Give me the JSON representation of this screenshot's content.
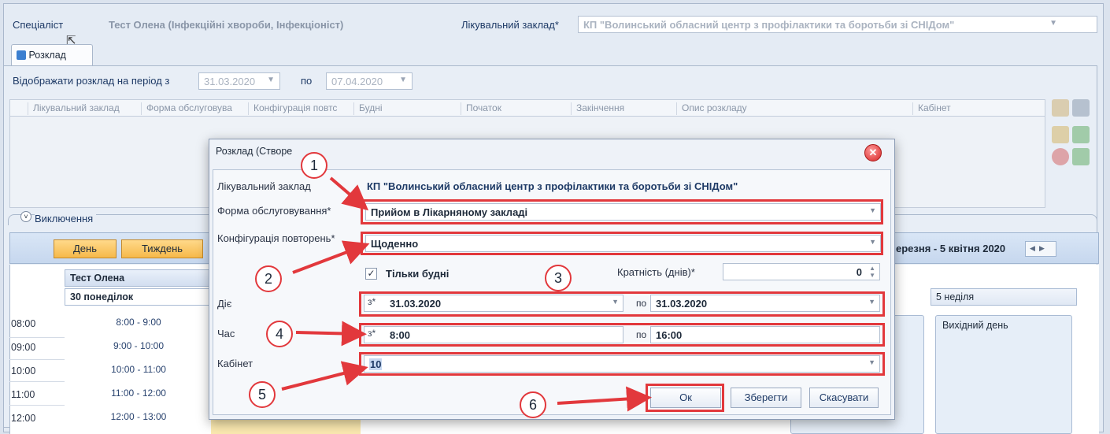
{
  "header": {
    "specialist_label": "Спеціаліст",
    "specialist_value": "Тест Олена (Інфекційні хвороби, Інфекціоніст)",
    "facility_label": "Лікувальний заклад*",
    "facility_value": "КП \"Волинський обласний центр з профілактики та боротьби зі СНІДом\""
  },
  "tab": {
    "label": "Розклад"
  },
  "period": {
    "label": "Відображати розклад на період з",
    "from": "31.03.2020",
    "to_label": "по",
    "to": "07.04.2020"
  },
  "grid": {
    "columns": [
      "Лікувальний заклад",
      "Форма обслуговува",
      "Конфігурація повтс",
      "Будні",
      "Початок",
      "Закінчення",
      "Опис розкладу",
      "Кабінет"
    ]
  },
  "exclusions": {
    "label": "Виключення"
  },
  "schedule": {
    "day_button": "День",
    "week_button": "Тиждень",
    "range_label": "ерезня - 5 квітня 2020",
    "person": "Тест Олена",
    "first_day": "30 понеділок",
    "last_day": "5 неділя",
    "day_off": "Вихідний день",
    "times": [
      "08:00",
      "09:00",
      "10:00",
      "11:00",
      "12:00"
    ],
    "slots": [
      "8:00 - 9:00",
      "9:00 - 10:00",
      "10:00 - 11:00",
      "11:00 - 12:00",
      "12:00 - 13:00"
    ]
  },
  "dialog": {
    "title": "Розклад (Створе",
    "facility_label": "Лікувальний заклад",
    "facility_value": "КП \"Волинський обласний центр з профілактики та боротьби зі СНІДом\"",
    "service_label": "Форма обслуговування*",
    "service_value": "Прийом в Лікарняному закладі",
    "repeat_label": "Конфігурація повторень*",
    "repeat_value": "Щоденно",
    "weekdays_only": "Тільки будні",
    "multiplicity_label": "Кратність (днів)*",
    "multiplicity_value": "0",
    "active_label": "Діє",
    "from_prefix": "з*",
    "active_from": "31.03.2020",
    "to_prefix": "по",
    "active_to": "31.03.2020",
    "time_label": "Час",
    "time_from": "8:00",
    "time_to": "16:00",
    "room_label": "Кабінет",
    "room_value": "10",
    "ok_button": "Ок",
    "save_button": "Зберегти",
    "cancel_button": "Скасувати"
  },
  "annotations": [
    "1",
    "2",
    "3",
    "4",
    "5",
    "6"
  ],
  "colors": {
    "highlight": "#e2383c",
    "accent": "#f6b94a"
  }
}
